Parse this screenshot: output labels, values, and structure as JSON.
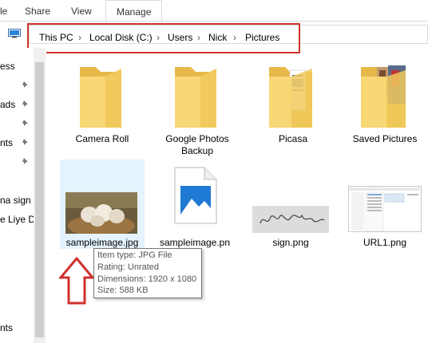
{
  "ribbon": {
    "tabs": [
      {
        "label": "le"
      },
      {
        "label": "Share"
      },
      {
        "label": "View"
      },
      {
        "label": "Manage"
      }
    ]
  },
  "address": {
    "crumbs": [
      "This PC",
      "Local Disk (C:)",
      "Users",
      "Nick",
      "Pictures"
    ],
    "separator": "›"
  },
  "nav": {
    "items": [
      {
        "label": "ess"
      },
      {
        "label": "ads"
      },
      {
        "label": "nts"
      },
      {
        "label": "na sign a"
      },
      {
        "label": "e Liye  D"
      },
      {
        "label": "nts"
      }
    ]
  },
  "files": [
    {
      "label_line1": "Camera Roll",
      "label_line2": "",
      "icon": "folder-icon"
    },
    {
      "label_line1": "Google Photos",
      "label_line2": "Backup",
      "icon": "folder-icon"
    },
    {
      "label_line1": "Picasa",
      "label_line2": "",
      "icon": "folder-with-documents-icon"
    },
    {
      "label_line1": "Saved Pictures",
      "label_line2": "",
      "icon": "folder-with-photos-icon"
    },
    {
      "label_line1": "sampleimage.jpg",
      "label_line2": "",
      "icon": "photo-thumbnail-puppies"
    },
    {
      "label_line1": "sampleimage.pn",
      "label_line2": "",
      "icon": "image-file-icon"
    },
    {
      "label_line1": "sign.png",
      "label_line2": "",
      "icon": "signature-thumbnail"
    },
    {
      "label_line1": "URL1.png",
      "label_line2": "",
      "icon": "screenshot-thumbnail"
    }
  ],
  "tooltip": {
    "lines": [
      "Item type: JPG File",
      "Rating: Unrated",
      "Dimensions: 1920 x 1080",
      "Size: 588 KB"
    ]
  },
  "colors": {
    "highlight_red": "#d0312d",
    "folder_yellow": "#f8d775",
    "folder_dark": "#e6b94a",
    "selection_blue": "#e5f3ff",
    "image_icon_blue": "#1f7ad4"
  }
}
